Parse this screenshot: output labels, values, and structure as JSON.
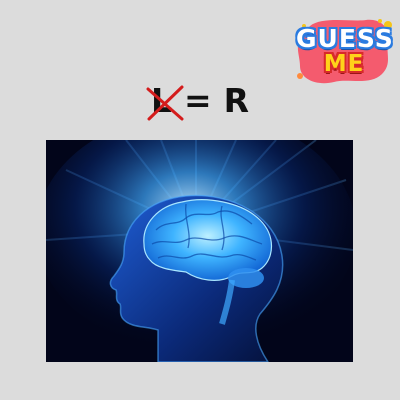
{
  "badge": {
    "line1": "GUESS",
    "line2": "ME",
    "colors": {
      "blob": "#f45b6e",
      "dots": [
        "#f5c518",
        "#ff8a3d"
      ]
    }
  },
  "clue": {
    "crossed_letter": "L",
    "operator": "=",
    "result": "R",
    "cross_color": "#d41c1c"
  },
  "picture": {
    "subject": "glowing-brain-profile",
    "colors": {
      "background": "#02051a",
      "glow": "#3fa9ff"
    }
  }
}
